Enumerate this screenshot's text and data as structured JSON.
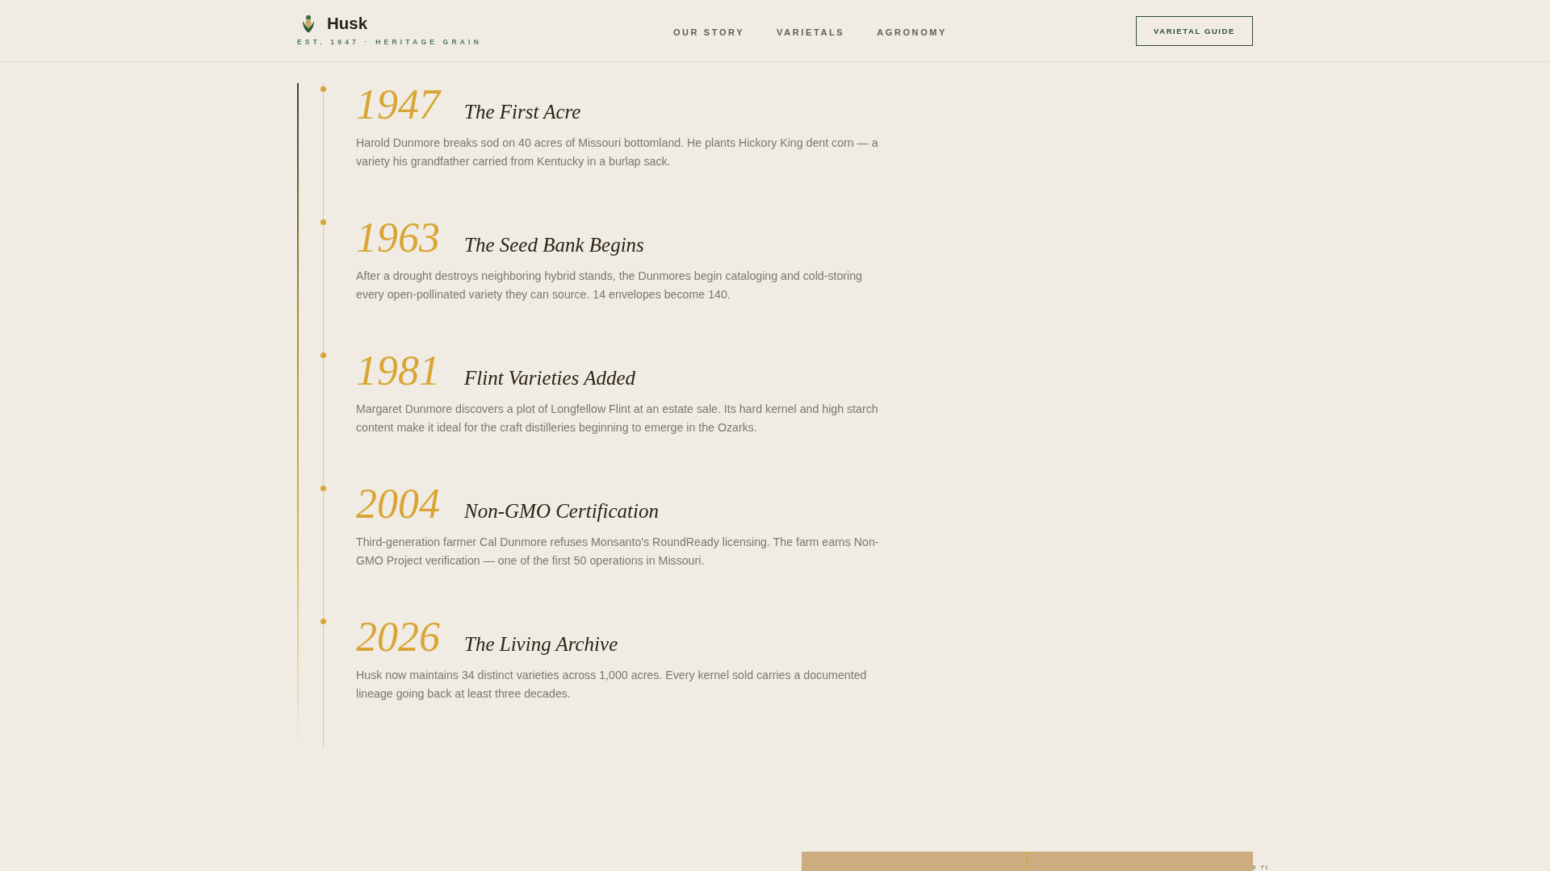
{
  "header": {
    "logo": {
      "name": "Husk",
      "tagline": "EST. 1947 · HERITAGE GRAIN"
    },
    "nav": [
      {
        "label": "OUR STORY"
      },
      {
        "label": "VARIETALS"
      },
      {
        "label": "AGRONOMY"
      }
    ],
    "cta": "VARIETAL GUIDE"
  },
  "timeline": [
    {
      "year": "1947",
      "title": "The First Acre",
      "text": "Harold Dunmore breaks sod on 40 acres of Missouri bottomland. He plants Hickory King dent corn — a variety his grandfather carried from Kentucky in a burlap sack."
    },
    {
      "year": "1963",
      "title": "The Seed Bank Begins",
      "text": "After a drought destroys neighboring hybrid stands, the Dunmores begin cataloging and cold-storing every open-pollinated variety they can source. 14 envelopes become 140."
    },
    {
      "year": "1981",
      "title": "Flint Varieties Added",
      "text": "Margaret Dunmore discovers a plot of Longfellow Flint at an estate sale. Its hard kernel and high starch content make it ideal for the craft distilleries beginning to emerge in the Ozarks."
    },
    {
      "year": "2004",
      "title": "Non-GMO Certification",
      "text": "Third-generation farmer Cal Dunmore refuses Monsanto's RoundReady licensing. The farm earns Non-GMO Project verification — one of the first 50 operations in Missouri."
    },
    {
      "year": "2026",
      "title": "The Living Archive",
      "text": "Husk now maintains 34 distinct varieties across 1,000 acres. Every kernel sold carries a documented lineage going back at least three decades."
    }
  ],
  "field_diagram": {
    "label": "0 ft"
  }
}
